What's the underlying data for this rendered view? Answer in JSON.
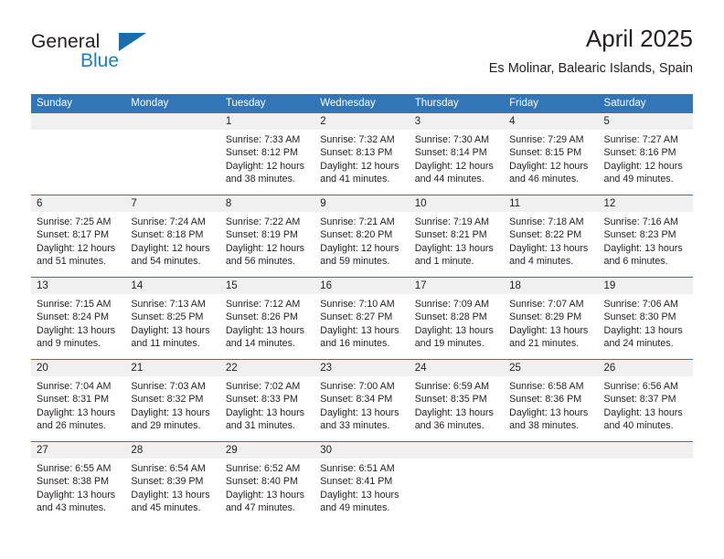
{
  "brand": {
    "word_top": "General",
    "word_bottom": "Blue",
    "logo_icon": "triangle-logo-icon"
  },
  "header": {
    "title": "April 2025",
    "location": "Es Molinar, Balearic Islands, Spain"
  },
  "colors": {
    "header_blue": "#3276b8",
    "band_gray": "#f0f0f0",
    "brand_blue": "#1c7fc4",
    "text": "#231f20"
  },
  "weekdays": [
    "Sunday",
    "Monday",
    "Tuesday",
    "Wednesday",
    "Thursday",
    "Friday",
    "Saturday"
  ],
  "weeks": [
    [
      {
        "date": "",
        "empty": true,
        "sunrise": "",
        "sunset": "",
        "daylight1": "",
        "daylight2": ""
      },
      {
        "date": "",
        "empty": true,
        "sunrise": "",
        "sunset": "",
        "daylight1": "",
        "daylight2": ""
      },
      {
        "date": "1",
        "empty": false,
        "sunrise": "Sunrise: 7:33 AM",
        "sunset": "Sunset: 8:12 PM",
        "daylight1": "Daylight: 12 hours",
        "daylight2": "and 38 minutes."
      },
      {
        "date": "2",
        "empty": false,
        "sunrise": "Sunrise: 7:32 AM",
        "sunset": "Sunset: 8:13 PM",
        "daylight1": "Daylight: 12 hours",
        "daylight2": "and 41 minutes."
      },
      {
        "date": "3",
        "empty": false,
        "sunrise": "Sunrise: 7:30 AM",
        "sunset": "Sunset: 8:14 PM",
        "daylight1": "Daylight: 12 hours",
        "daylight2": "and 44 minutes."
      },
      {
        "date": "4",
        "empty": false,
        "sunrise": "Sunrise: 7:29 AM",
        "sunset": "Sunset: 8:15 PM",
        "daylight1": "Daylight: 12 hours",
        "daylight2": "and 46 minutes."
      },
      {
        "date": "5",
        "empty": false,
        "sunrise": "Sunrise: 7:27 AM",
        "sunset": "Sunset: 8:16 PM",
        "daylight1": "Daylight: 12 hours",
        "daylight2": "and 49 minutes."
      }
    ],
    [
      {
        "date": "6",
        "empty": false,
        "sunrise": "Sunrise: 7:25 AM",
        "sunset": "Sunset: 8:17 PM",
        "daylight1": "Daylight: 12 hours",
        "daylight2": "and 51 minutes."
      },
      {
        "date": "7",
        "empty": false,
        "sunrise": "Sunrise: 7:24 AM",
        "sunset": "Sunset: 8:18 PM",
        "daylight1": "Daylight: 12 hours",
        "daylight2": "and 54 minutes."
      },
      {
        "date": "8",
        "empty": false,
        "sunrise": "Sunrise: 7:22 AM",
        "sunset": "Sunset: 8:19 PM",
        "daylight1": "Daylight: 12 hours",
        "daylight2": "and 56 minutes."
      },
      {
        "date": "9",
        "empty": false,
        "sunrise": "Sunrise: 7:21 AM",
        "sunset": "Sunset: 8:20 PM",
        "daylight1": "Daylight: 12 hours",
        "daylight2": "and 59 minutes."
      },
      {
        "date": "10",
        "empty": false,
        "sunrise": "Sunrise: 7:19 AM",
        "sunset": "Sunset: 8:21 PM",
        "daylight1": "Daylight: 13 hours",
        "daylight2": "and 1 minute."
      },
      {
        "date": "11",
        "empty": false,
        "sunrise": "Sunrise: 7:18 AM",
        "sunset": "Sunset: 8:22 PM",
        "daylight1": "Daylight: 13 hours",
        "daylight2": "and 4 minutes."
      },
      {
        "date": "12",
        "empty": false,
        "sunrise": "Sunrise: 7:16 AM",
        "sunset": "Sunset: 8:23 PM",
        "daylight1": "Daylight: 13 hours",
        "daylight2": "and 6 minutes."
      }
    ],
    [
      {
        "date": "13",
        "empty": false,
        "sunrise": "Sunrise: 7:15 AM",
        "sunset": "Sunset: 8:24 PM",
        "daylight1": "Daylight: 13 hours",
        "daylight2": "and 9 minutes."
      },
      {
        "date": "14",
        "empty": false,
        "sunrise": "Sunrise: 7:13 AM",
        "sunset": "Sunset: 8:25 PM",
        "daylight1": "Daylight: 13 hours",
        "daylight2": "and 11 minutes."
      },
      {
        "date": "15",
        "empty": false,
        "sunrise": "Sunrise: 7:12 AM",
        "sunset": "Sunset: 8:26 PM",
        "daylight1": "Daylight: 13 hours",
        "daylight2": "and 14 minutes."
      },
      {
        "date": "16",
        "empty": false,
        "sunrise": "Sunrise: 7:10 AM",
        "sunset": "Sunset: 8:27 PM",
        "daylight1": "Daylight: 13 hours",
        "daylight2": "and 16 minutes."
      },
      {
        "date": "17",
        "empty": false,
        "sunrise": "Sunrise: 7:09 AM",
        "sunset": "Sunset: 8:28 PM",
        "daylight1": "Daylight: 13 hours",
        "daylight2": "and 19 minutes."
      },
      {
        "date": "18",
        "empty": false,
        "sunrise": "Sunrise: 7:07 AM",
        "sunset": "Sunset: 8:29 PM",
        "daylight1": "Daylight: 13 hours",
        "daylight2": "and 21 minutes."
      },
      {
        "date": "19",
        "empty": false,
        "sunrise": "Sunrise: 7:06 AM",
        "sunset": "Sunset: 8:30 PM",
        "daylight1": "Daylight: 13 hours",
        "daylight2": "and 24 minutes."
      }
    ],
    [
      {
        "date": "20",
        "empty": false,
        "sunrise": "Sunrise: 7:04 AM",
        "sunset": "Sunset: 8:31 PM",
        "daylight1": "Daylight: 13 hours",
        "daylight2": "and 26 minutes."
      },
      {
        "date": "21",
        "empty": false,
        "sunrise": "Sunrise: 7:03 AM",
        "sunset": "Sunset: 8:32 PM",
        "daylight1": "Daylight: 13 hours",
        "daylight2": "and 29 minutes."
      },
      {
        "date": "22",
        "empty": false,
        "sunrise": "Sunrise: 7:02 AM",
        "sunset": "Sunset: 8:33 PM",
        "daylight1": "Daylight: 13 hours",
        "daylight2": "and 31 minutes."
      },
      {
        "date": "23",
        "empty": false,
        "sunrise": "Sunrise: 7:00 AM",
        "sunset": "Sunset: 8:34 PM",
        "daylight1": "Daylight: 13 hours",
        "daylight2": "and 33 minutes."
      },
      {
        "date": "24",
        "empty": false,
        "sunrise": "Sunrise: 6:59 AM",
        "sunset": "Sunset: 8:35 PM",
        "daylight1": "Daylight: 13 hours",
        "daylight2": "and 36 minutes."
      },
      {
        "date": "25",
        "empty": false,
        "sunrise": "Sunrise: 6:58 AM",
        "sunset": "Sunset: 8:36 PM",
        "daylight1": "Daylight: 13 hours",
        "daylight2": "and 38 minutes."
      },
      {
        "date": "26",
        "empty": false,
        "sunrise": "Sunrise: 6:56 AM",
        "sunset": "Sunset: 8:37 PM",
        "daylight1": "Daylight: 13 hours",
        "daylight2": "and 40 minutes."
      }
    ],
    [
      {
        "date": "27",
        "empty": false,
        "sunrise": "Sunrise: 6:55 AM",
        "sunset": "Sunset: 8:38 PM",
        "daylight1": "Daylight: 13 hours",
        "daylight2": "and 43 minutes."
      },
      {
        "date": "28",
        "empty": false,
        "sunrise": "Sunrise: 6:54 AM",
        "sunset": "Sunset: 8:39 PM",
        "daylight1": "Daylight: 13 hours",
        "daylight2": "and 45 minutes."
      },
      {
        "date": "29",
        "empty": false,
        "sunrise": "Sunrise: 6:52 AM",
        "sunset": "Sunset: 8:40 PM",
        "daylight1": "Daylight: 13 hours",
        "daylight2": "and 47 minutes."
      },
      {
        "date": "30",
        "empty": false,
        "sunrise": "Sunrise: 6:51 AM",
        "sunset": "Sunset: 8:41 PM",
        "daylight1": "Daylight: 13 hours",
        "daylight2": "and 49 minutes."
      },
      {
        "date": "",
        "empty": true,
        "sunrise": "",
        "sunset": "",
        "daylight1": "",
        "daylight2": ""
      },
      {
        "date": "",
        "empty": true,
        "sunrise": "",
        "sunset": "",
        "daylight1": "",
        "daylight2": ""
      },
      {
        "date": "",
        "empty": true,
        "sunrise": "",
        "sunset": "",
        "daylight1": "",
        "daylight2": ""
      }
    ]
  ]
}
